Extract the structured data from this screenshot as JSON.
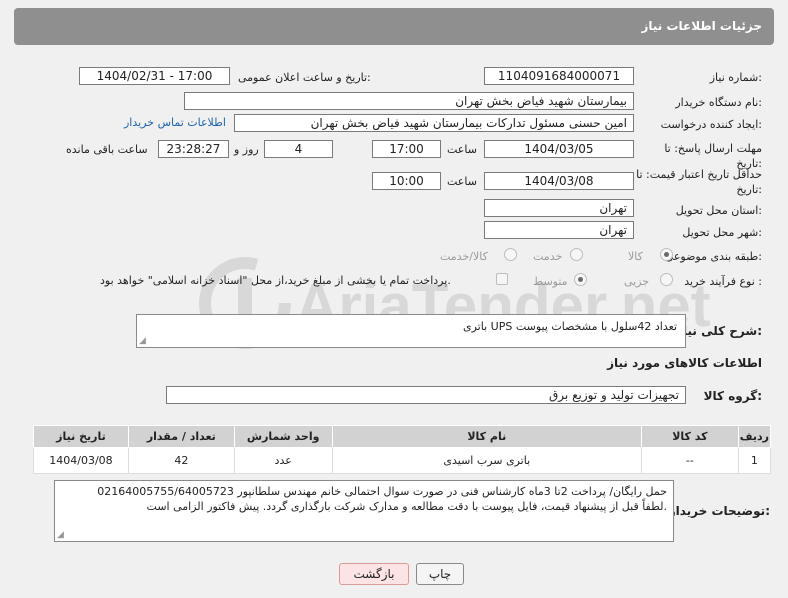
{
  "header": {
    "title": "جزئیات اطلاعات نیاز"
  },
  "form": {
    "need_number_label": "شماره نیاز:",
    "need_number": "1104091684000071",
    "announce_label": "تاریخ و ساعت اعلان عمومی:",
    "announce_value": "1404/02/31 - 17:00",
    "buyer_org_label": "نام دستگاه خریدار:",
    "buyer_org": "بیمارستان شهید فیاض بخش تهران",
    "creator_label": "ایجاد کننده درخواست:",
    "creator": "امین حسنی مسئول تدارکات بیمارستان شهید فیاض بخش تهران",
    "contact_link": "اطلاعات تماس خریدار",
    "reply_deadline_label": "مهلت ارسال پاسخ: تا تاریخ:",
    "reply_date": "1404/03/05",
    "time_label": "ساعت",
    "reply_time": "17:00",
    "days_value": "4",
    "days_label": "روز و",
    "remaining_time": "23:28:27",
    "remaining_label": "ساعت باقی مانده",
    "price_validity_label": "حداقل تاریخ اعتبار قیمت: تا تاریخ:",
    "price_date": "1404/03/08",
    "price_time": "10:00",
    "province_label": "استان محل تحویل:",
    "province": "تهران",
    "city_label": "شهر محل تحویل:",
    "city": "تهران",
    "category_label": "طبقه بندی موضوعی:",
    "category_options": [
      "کالا",
      "خدمت",
      "کالا/خدمت"
    ],
    "process_label": "نوع فرآیند خرید :",
    "process_options": [
      "جزیی",
      "متوسط"
    ],
    "payment_note": "پرداخت تمام یا بخشی از مبلغ خرید،از محل \"اسناد خزانه اسلامی\" خواهد بود."
  },
  "description": {
    "label": "شرح کلی نیاز:",
    "text": "باتری UPS تعداد 42سلول با مشخصات پیوست"
  },
  "goods": {
    "section_title": "اطلاعات کالاهای مورد نیاز",
    "group_label": "گروه کالا:",
    "group_value": "تجهیزات تولید و توزیع برق",
    "columns": [
      "ردیف",
      "کد کالا",
      "نام کالا",
      "واحد شمارش",
      "تعداد / مقدار",
      "تاریخ نیاز"
    ],
    "rows": [
      {
        "row": "1",
        "code": "--",
        "name": "باتری سرب اسیدی",
        "unit": "عدد",
        "qty": "42",
        "date": "1404/03/08"
      }
    ]
  },
  "notes": {
    "label": "توضیحات خریدار:",
    "line1": "حمل رایگان/ پرداخت 2تا 3ماه کارشناس فنی در صورت سوال احتمالی خانم مهندس سلطانپور 02164005755/64005723",
    "line2": "لطفاً قبل از پیشنهاد قیمت، فایل پیوست با دقت مطالعه و مدارک شرکت بارگذاری گردد.  پیش فاکتور الزامی است."
  },
  "buttons": {
    "back": "بازگشت",
    "print": "چاپ"
  },
  "watermark": {
    "text": "AriaTender.net"
  },
  "colors": {
    "header_bg": "#8f8f8f",
    "link": "#1e63b0",
    "table_header": "#d2d2d2"
  }
}
